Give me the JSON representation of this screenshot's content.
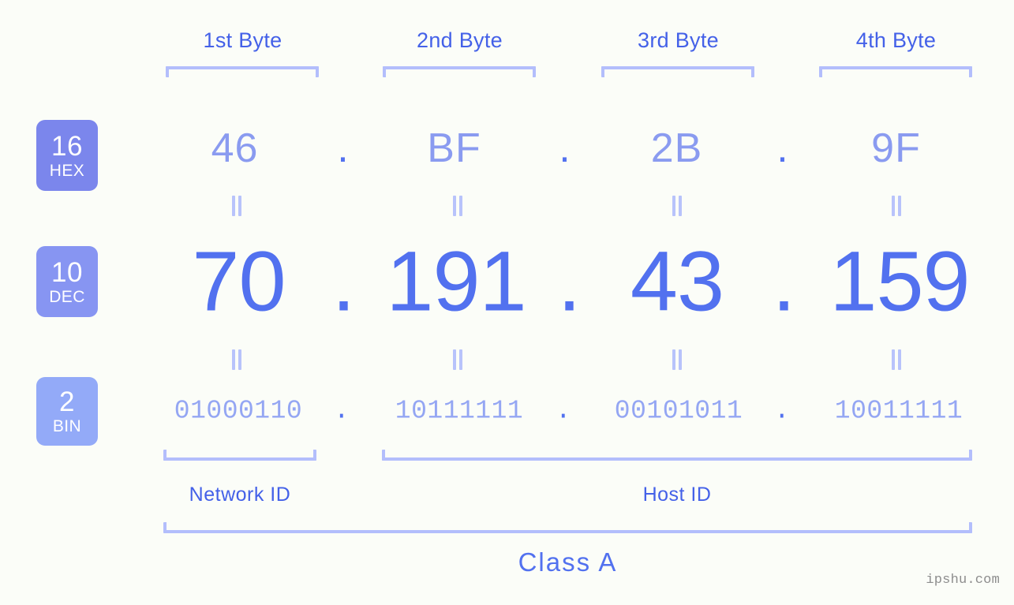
{
  "headers": [
    {
      "label": "1st Byte"
    },
    {
      "label": "2nd Byte"
    },
    {
      "label": "3rd Byte"
    },
    {
      "label": "4th Byte"
    }
  ],
  "bases": [
    {
      "num": "16",
      "abbr": "HEX",
      "color": "#7b86ec"
    },
    {
      "num": "10",
      "abbr": "DEC",
      "color": "#8795f2"
    },
    {
      "num": "2",
      "abbr": "BIN",
      "color": "#93aaf8"
    }
  ],
  "separator": ".",
  "rows": {
    "hex": {
      "base": "16",
      "values": [
        "46",
        "BF",
        "2B",
        "9F"
      ]
    },
    "dec": {
      "base": "10",
      "values": [
        "70",
        "191",
        "43",
        "159"
      ]
    },
    "bin": {
      "base": "2",
      "values": [
        "01000110",
        "10111111",
        "00101011",
        "10011111"
      ]
    }
  },
  "equality_symbol": "=",
  "segments": {
    "network_id": "Network ID",
    "host_id": "Host ID"
  },
  "class_label": "Class A",
  "watermark": "ipshu.com",
  "colors": {
    "background": "#fbfdf8",
    "bracket": "#b3befc",
    "header_text": "#4461e8",
    "hex_text": "#8a9bf0",
    "dec_text": "#5271ef",
    "bin_text": "#94a6f3",
    "watermark_text": "#8d8d8d"
  }
}
